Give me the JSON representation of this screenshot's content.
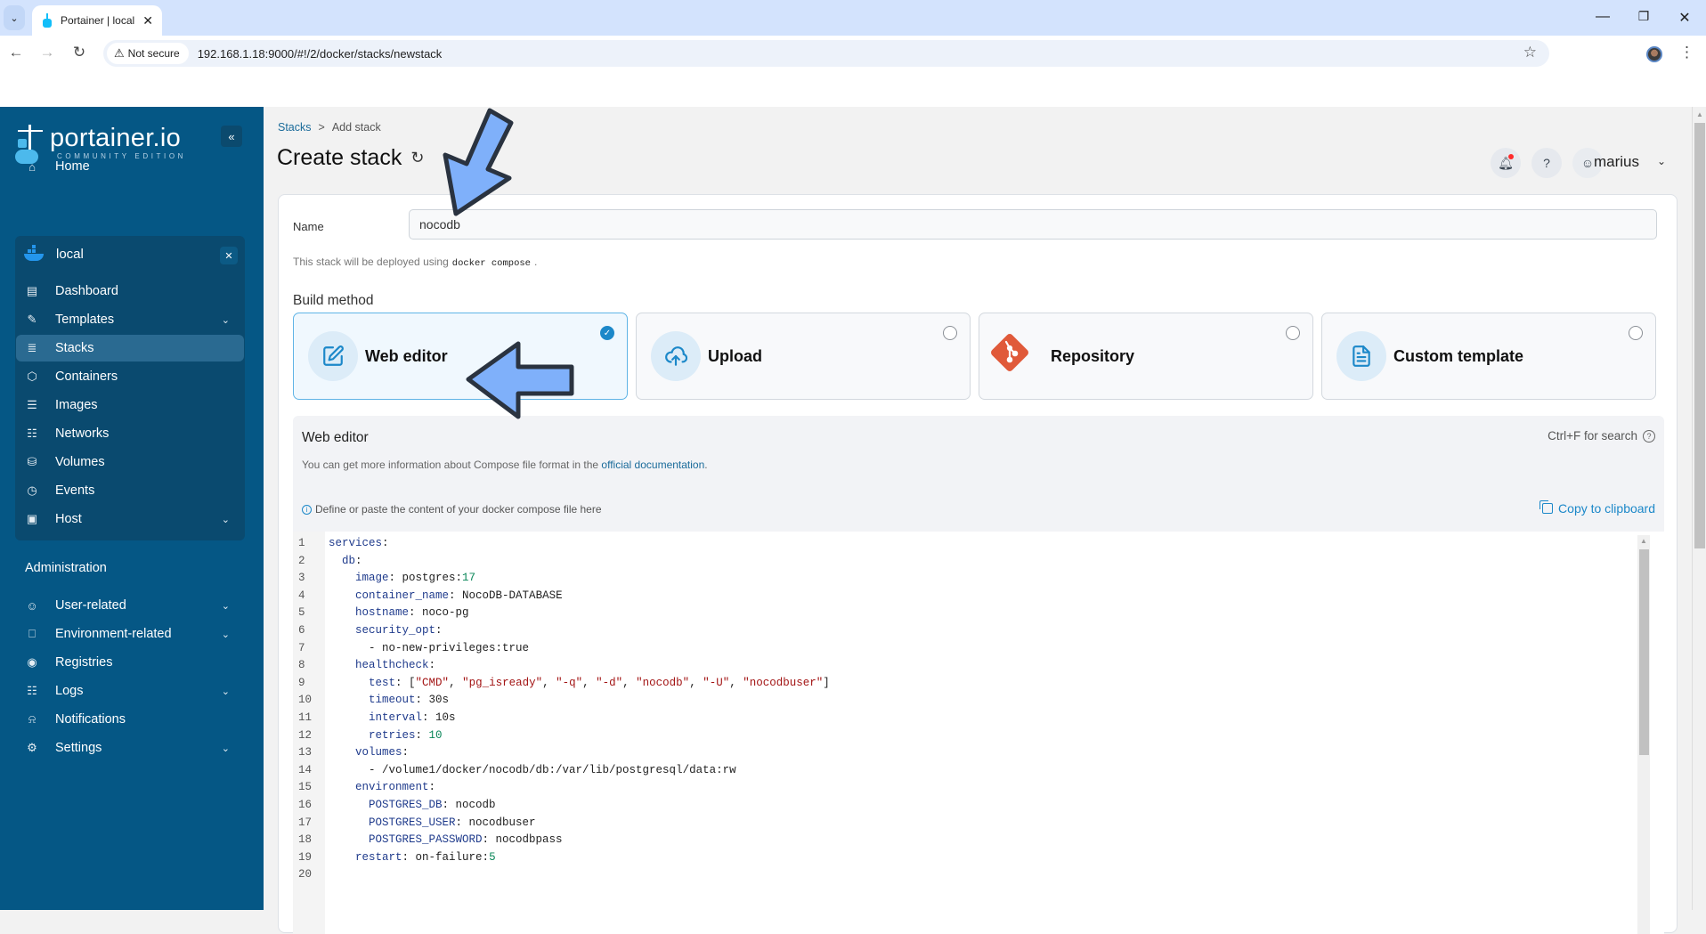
{
  "browser": {
    "tab_title": "Portainer | local",
    "not_secure_label": "Not secure",
    "url": "192.168.1.18:9000/#!/2/docker/stacks/newstack"
  },
  "sidebar": {
    "logo_name": "portainer.io",
    "logo_edition": "COMMUNITY EDITION",
    "home_label": "Home",
    "environment": {
      "name": "local",
      "items": [
        {
          "label": "Dashboard",
          "icon": "dashboard-icon",
          "chevron": false
        },
        {
          "label": "Templates",
          "icon": "edit-icon",
          "chevron": true
        },
        {
          "label": "Stacks",
          "icon": "layers-icon",
          "chevron": false,
          "active": true
        },
        {
          "label": "Containers",
          "icon": "box-icon",
          "chevron": false
        },
        {
          "label": "Images",
          "icon": "list-icon",
          "chevron": false
        },
        {
          "label": "Networks",
          "icon": "network-icon",
          "chevron": false
        },
        {
          "label": "Volumes",
          "icon": "database-icon",
          "chevron": false
        },
        {
          "label": "Events",
          "icon": "clock-icon",
          "chevron": false
        },
        {
          "label": "Host",
          "icon": "host-icon",
          "chevron": true
        }
      ]
    },
    "admin_label": "Administration",
    "admin_items": [
      {
        "label": "User-related",
        "icon": "users-icon",
        "chevron": true
      },
      {
        "label": "Environment-related",
        "icon": "drive-icon",
        "chevron": true
      },
      {
        "label": "Registries",
        "icon": "radio-icon",
        "chevron": false
      },
      {
        "label": "Logs",
        "icon": "file-icon",
        "chevron": true
      },
      {
        "label": "Notifications",
        "icon": "bell-icon",
        "chevron": false
      },
      {
        "label": "Settings",
        "icon": "gear-icon",
        "chevron": true
      }
    ]
  },
  "header": {
    "breadcrumb_root": "Stacks",
    "breadcrumb_sep": ">",
    "breadcrumb_current": "Add stack",
    "title": "Create stack",
    "user": "marius"
  },
  "form": {
    "name_label": "Name",
    "name_value": "nocodb",
    "deploy_note_prefix": "This stack will be deployed using",
    "deploy_note_code": "docker compose",
    "deploy_note_suffix": ".",
    "build_method_label": "Build method",
    "methods": [
      {
        "label": "Web editor",
        "selected": true
      },
      {
        "label": "Upload",
        "selected": false
      },
      {
        "label": "Repository",
        "selected": false
      },
      {
        "label": "Custom template",
        "selected": false
      }
    ]
  },
  "editor": {
    "title": "Web editor",
    "search_hint": "Ctrl+F for search",
    "info_prefix": "You can get more information about Compose file format in the",
    "info_link": "official documentation",
    "info_suffix": ".",
    "define_hint": "Define or paste the content of your docker compose file here",
    "copy_label": "Copy to clipboard",
    "lines": [
      "services:",
      "  db:",
      "    image: postgres:17",
      "    container_name: NocoDB-DATABASE",
      "    hostname: noco-pg",
      "    security_opt:",
      "      - no-new-privileges:true",
      "    healthcheck:",
      "      test: [\"CMD\", \"pg_isready\", \"-q\", \"-d\", \"nocodb\", \"-U\", \"nocodbuser\"]",
      "      timeout: 30s",
      "      interval: 10s",
      "      retries: 10",
      "    volumes:",
      "      - /volume1/docker/nocodb/db:/var/lib/postgresql/data:rw",
      "    environment:",
      "      POSTGRES_DB: nocodb",
      "      POSTGRES_USER: nocodbuser",
      "      POSTGRES_PASSWORD: nocodbpass",
      "    restart: on-failure:5",
      ""
    ]
  },
  "colors": {
    "sidebar_bg": "#055785",
    "accent": "#1c88c9",
    "annotation_arrow": "#7fb0fa"
  }
}
